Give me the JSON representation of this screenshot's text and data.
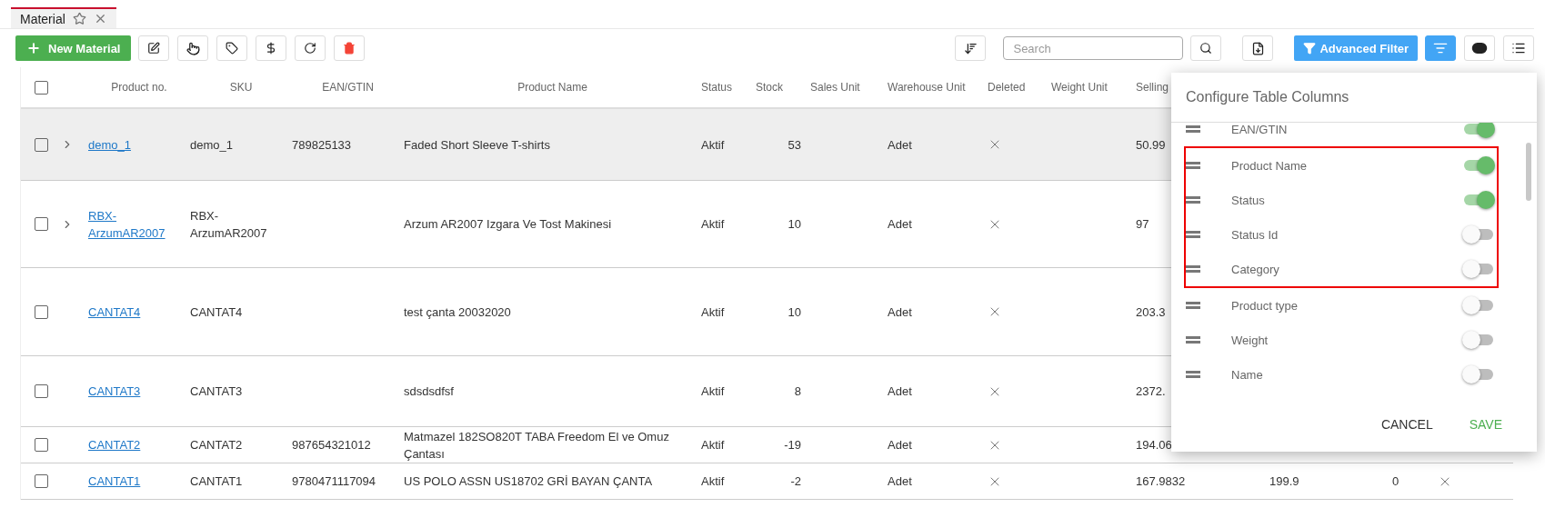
{
  "tab": {
    "label": "Material",
    "selected": true
  },
  "toolbar": {
    "new_button": "New Material",
    "search": {
      "placeholder": "Search"
    },
    "advanced_filter": "Advanced Filter",
    "filter_active": true
  },
  "table": {
    "select_all_checked": false,
    "columns": [
      "Product no.",
      "SKU",
      "EAN/GTIN",
      "Product Name",
      "Status",
      "Stock",
      "Sales Unit",
      "Warehouse Unit",
      "Deleted",
      "Weight Unit",
      "Selling"
    ],
    "rows": [
      {
        "expandable": true,
        "selected": true,
        "product_no": "demo_1",
        "sku": "demo_1",
        "ean": "789825133",
        "name": "Faded Short Sleeve T-shirts",
        "status": "Aktif",
        "stock": "53",
        "warehouse_unit": "Adet",
        "deleted": false,
        "selling": "50.99"
      },
      {
        "expandable": true,
        "selected": false,
        "product_no": "RBX-ArzumAR2007",
        "sku": "RBX-ArzumAR2007",
        "name": "Arzum AR2007 Izgara Ve Tost Makinesi",
        "status": "Aktif",
        "stock": "10",
        "warehouse_unit": "Adet",
        "deleted": false,
        "selling": "97"
      },
      {
        "expandable": false,
        "selected": false,
        "product_no": "CANTAT4",
        "sku": "CANTAT4",
        "name": "test çanta 20032020",
        "status": "Aktif",
        "stock": "10",
        "warehouse_unit": "Adet",
        "deleted": false,
        "selling": "203.3"
      },
      {
        "expandable": false,
        "selected": false,
        "product_no": "CANTAT3",
        "sku": "CANTAT3",
        "name": "sdsdsdfsf",
        "status": "Aktif",
        "stock": "8",
        "warehouse_unit": "Adet",
        "deleted": false,
        "selling": "2372."
      },
      {
        "expandable": false,
        "selected": false,
        "product_no": "CANTAT2",
        "sku": "CANTAT2",
        "ean": "987654321012",
        "name": "Matmazel 182SO820T TABA Freedom El ve Omuz Çantası",
        "status": "Aktif",
        "stock": "-19",
        "warehouse_unit": "Adet",
        "deleted": false,
        "selling": "194.06"
      },
      {
        "expandable": false,
        "selected": false,
        "product_no": "CANTAT1",
        "sku": "CANTAT1",
        "ean": "9780471117094",
        "name": "US POLO ASSN US18702 GRİ BAYAN ÇANTA",
        "status": "Aktif",
        "stock": "-2",
        "warehouse_unit": "Adet",
        "deleted": false,
        "selling": "167.9832",
        "column_13": "199.9",
        "column_14": "0",
        "column_15_flag": false
      }
    ]
  },
  "column_dialog": {
    "title": "Configure Table Columns",
    "items": [
      {
        "label": "EAN/GTIN",
        "on": true,
        "highlighted": false
      },
      {
        "label": "Product Name",
        "on": true,
        "highlighted": true
      },
      {
        "label": "Status",
        "on": true,
        "highlighted": true
      },
      {
        "label": "Status Id",
        "on": false,
        "highlighted": true
      },
      {
        "label": "Category",
        "on": false,
        "highlighted": true
      },
      {
        "label": "Product type",
        "on": false,
        "highlighted": false
      },
      {
        "label": "Weight",
        "on": false,
        "highlighted": false
      },
      {
        "label": "Name",
        "on": false,
        "highlighted": false
      }
    ],
    "cancel": "CANCEL",
    "save": "SAVE"
  }
}
